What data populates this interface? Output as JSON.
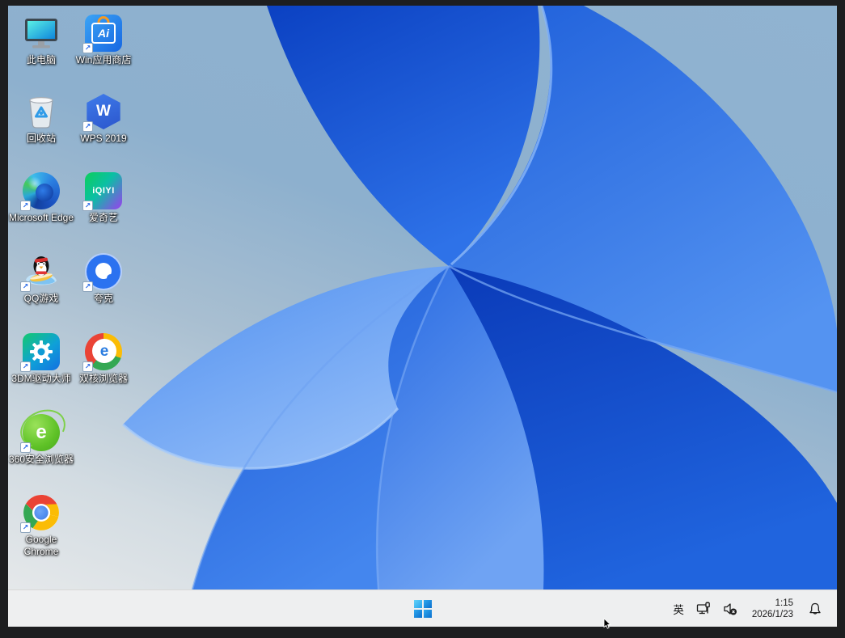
{
  "desktop": {
    "icons": [
      {
        "name": "this-pc",
        "label": "此电脑",
        "shortcut": false
      },
      {
        "name": "win-app-store",
        "label": "Win应用商店",
        "shortcut": true,
        "glyph": "Ai"
      },
      {
        "name": "recycle-bin",
        "label": "回收站",
        "shortcut": false,
        "glyph": "♻"
      },
      {
        "name": "wps-2019",
        "label": "WPS 2019",
        "shortcut": true,
        "glyph": "W"
      },
      {
        "name": "microsoft-edge",
        "label": "Microsoft Edge",
        "shortcut": true
      },
      {
        "name": "iqiyi",
        "label": "爱奇艺",
        "shortcut": true,
        "glyph": "iQIYI"
      },
      {
        "name": "qq-games",
        "label": "QQ游戏",
        "shortcut": true
      },
      {
        "name": "quark",
        "label": "夸克",
        "shortcut": true
      },
      {
        "name": "3dm-driver-master",
        "label": "3DM驱动大师",
        "shortcut": true
      },
      {
        "name": "dual-core-browser",
        "label": "双核浏览器",
        "shortcut": true,
        "glyph": "e"
      },
      {
        "name": "360-secure-browser",
        "label": "360安全浏览器",
        "shortcut": true,
        "glyph": "e"
      },
      {
        "name": "google-chrome",
        "label": "Google Chrome",
        "shortcut": true
      }
    ],
    "shortcut_arrow": "↗"
  },
  "taskbar": {
    "tray": {
      "input_language": "英",
      "time": "1:15",
      "date": "2026/1/23"
    }
  },
  "colors": {
    "frame": "#1d1e20",
    "taskbar_bg": "#eeeff0",
    "wallpaper_top": "#8db0ce",
    "wallpaper_bottom": "#e5e8ea",
    "bloom_deep_blue": "#0b41c2",
    "bloom_light_blue": "#93bdf8",
    "start_blue": "#0a6fce"
  }
}
